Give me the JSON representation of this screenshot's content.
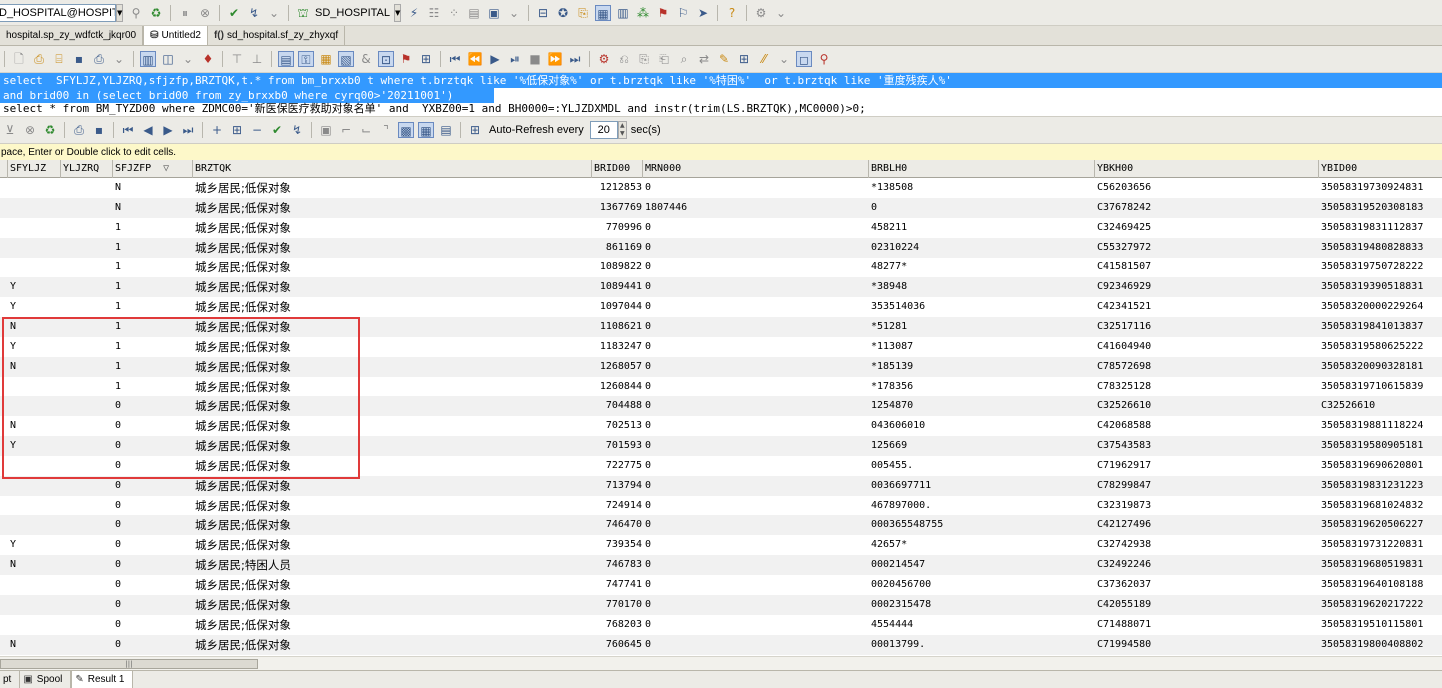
{
  "topbar": {
    "connection": "D_HOSPITAL@HOSPITAL",
    "connection_label": "SD_HOSPITAL"
  },
  "tabs": [
    {
      "label": "hospital.sp_zy_wdfctk_jkqr00",
      "icon": "procedure-icon"
    },
    {
      "label": "Untitled2",
      "icon": "sql-window-icon",
      "active": true
    },
    {
      "label": "sd_hospital.sf_zy_zhyxqf",
      "icon": "function-icon"
    }
  ],
  "sql_lines": [
    "select  SFYLJZ,YLJZRQ,sfjzfp,BRZTQK,t.* from bm_brxxb0 t where t.brztqk like '%低保对象%' or t.brztqk like '%特困%'  or t.brztqk like '重度残疾人%'",
    "and brid00 in (select brid00 from zy_brxxb0 where cyrq00>'20211001')",
    "select * from BM_TYZD00 where ZDMC00='新医保医疗救助对象名单' and  YXBZ00=1 and BH0000=:YLJZDXMDL and instr(trim(LS.BRZTQK),MC0000)>0;"
  ],
  "result_toolbar": {
    "auto_refresh_label": "Auto-Refresh every",
    "auto_refresh_value": "20",
    "auto_refresh_unit": "sec(s)"
  },
  "hint": "pace, Enter or Double click to edit cells.",
  "columns": [
    "SFYLJZ",
    "YLJZRQ",
    "SFJZFP",
    "BRZTQK",
    "BRID00",
    "MRN000",
    "BRBLH0",
    "YBKH00",
    "YBID00"
  ],
  "sort_indicator": "▽",
  "rows": [
    [
      "",
      "",
      "N",
      "城乡居民;低保对象",
      "1212853",
      "0",
      "*138508",
      "C56203656",
      "35058319730924831"
    ],
    [
      "",
      "",
      "N",
      "城乡居民;低保对象",
      "1367769",
      "1807446",
      "0",
      "C37678242",
      "35058319520308183"
    ],
    [
      "",
      "",
      "1",
      "城乡居民;低保对象",
      "770996",
      "0",
      "458211",
      "C32469425",
      "35058319831112837"
    ],
    [
      "",
      "",
      "1",
      "城乡居民;低保对象",
      "861169",
      "0",
      "02310224",
      "C55327972",
      "35058319480828833"
    ],
    [
      "",
      "",
      "1",
      "城乡居民;低保对象",
      "1089822",
      "0",
      "48277*",
      "C41581507",
      "35058319750728222"
    ],
    [
      "Y",
      "",
      "1",
      "城乡居民;低保对象",
      "1089441",
      "0",
      "*38948",
      "C92346929",
      "35058319390518831"
    ],
    [
      "Y",
      "",
      "1",
      "城乡居民;低保对象",
      "1097044",
      "0",
      "353514036",
      "C42341521",
      "35058320000229264"
    ],
    [
      "N",
      "",
      "1",
      "城乡居民;低保对象",
      "1108621",
      "0",
      "*51281",
      "C32517116",
      "35058319841013837"
    ],
    [
      "Y",
      "",
      "1",
      "城乡居民;低保对象",
      "1183247",
      "0",
      "*113087",
      "C41604940",
      "35058319580625222"
    ],
    [
      "N",
      "",
      "1",
      "城乡居民;低保对象",
      "1268057",
      "0",
      "*185139",
      "C78572698",
      "35058320090328181"
    ],
    [
      "",
      "",
      "1",
      "城乡居民;低保对象",
      "1260844",
      "0",
      "*178356",
      "C78325128",
      "35058319710615839"
    ],
    [
      "",
      "",
      "0",
      "城乡居民;低保对象",
      "704488",
      "0",
      "1254870",
      "C32526610",
      "C32526610"
    ],
    [
      "N",
      "",
      "0",
      "城乡居民;低保对象",
      "702513",
      "0",
      "043606010",
      "C42068588",
      "35058319881118224"
    ],
    [
      "Y",
      "",
      "0",
      "城乡居民;低保对象",
      "701593",
      "0",
      "125669",
      "C37543583",
      "35058319580905181"
    ],
    [
      "",
      "",
      "0",
      "城乡居民;低保对象",
      "722775",
      "0",
      "005455.",
      "C71962917",
      "35058319690620801"
    ],
    [
      "",
      "",
      "0",
      "城乡居民;低保对象",
      "713794",
      "0",
      "0036697711",
      "C78299847",
      "35058319831231223"
    ],
    [
      "",
      "",
      "0",
      "城乡居民;低保对象",
      "724914",
      "0",
      "467897000.",
      "C32319873",
      "35058319681024832"
    ],
    [
      "",
      "",
      "0",
      "城乡居民;低保对象",
      "746470",
      "0",
      "000365548755",
      "C42127496",
      "35058319620506227"
    ],
    [
      "Y",
      "",
      "0",
      "城乡居民;低保对象",
      "739354",
      "0",
      "42657*",
      "C32742938",
      "35058319731220831"
    ],
    [
      "N",
      "",
      "0",
      "城乡居民;特困人员",
      "746783",
      "0",
      "000214547",
      "C32492246",
      "35058319680519831"
    ],
    [
      "",
      "",
      "0",
      "城乡居民;低保对象",
      "747741",
      "0",
      "0020456700",
      "C37362037",
      "35058319640108188"
    ],
    [
      "",
      "",
      "0",
      "城乡居民;低保对象",
      "770170",
      "0",
      "0002315478",
      "C42055189",
      "35058319620217222"
    ],
    [
      "",
      "",
      "0",
      "城乡居民;低保对象",
      "768203",
      "0",
      "4554444",
      "C71488071",
      "35058319510115801"
    ],
    [
      "N",
      "",
      "0",
      "城乡居民;低保对象",
      "760645",
      "0",
      "00013799.",
      "C71994580",
      "35058319800408802"
    ]
  ],
  "bottom_tabs": [
    {
      "label": "pt",
      "icon": ""
    },
    {
      "label": "Spool",
      "icon": "spool-icon"
    },
    {
      "label": "Result 1",
      "icon": "result-grid-icon",
      "active": true
    }
  ],
  "highlight_color": "#e03a3a"
}
